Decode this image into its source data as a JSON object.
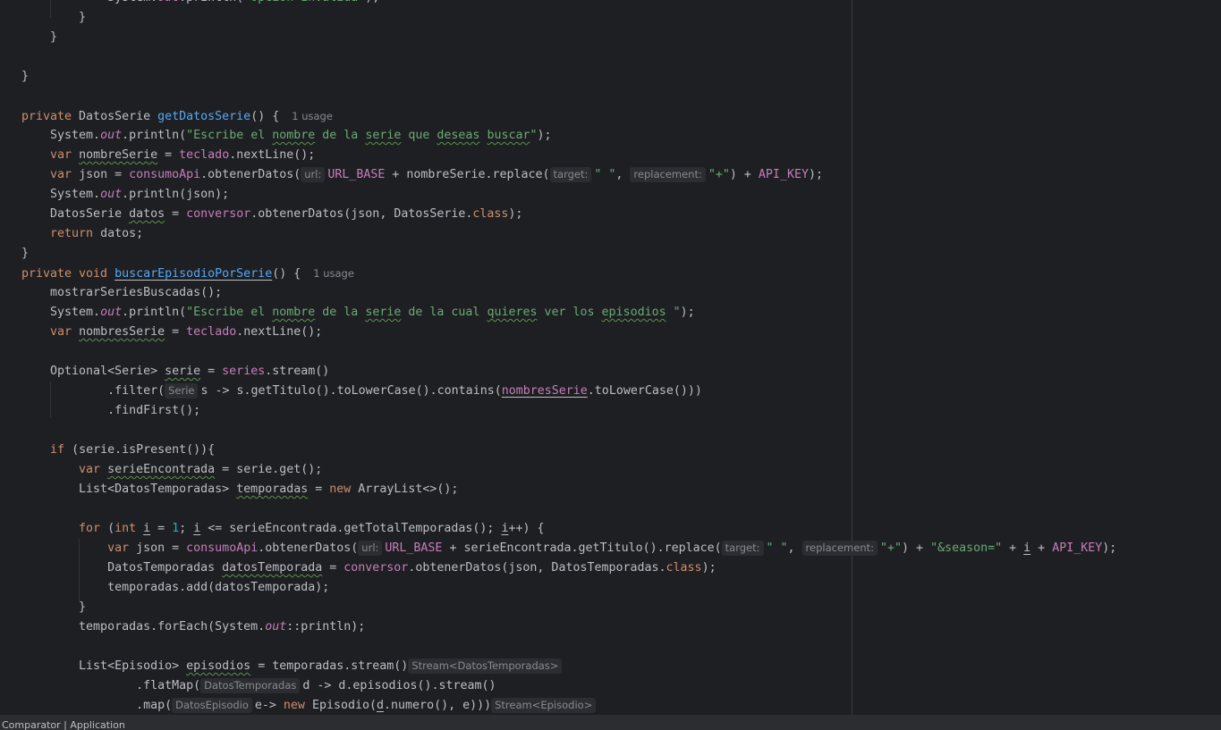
{
  "editor": {
    "lines": [
      [
        {
          "t": "            System.",
          "c": ""
        },
        {
          "t": "out",
          "c": "fld it"
        },
        {
          "t": ".println(",
          "c": ""
        },
        {
          "t": "\"Opcion invalida\"",
          "c": "st"
        },
        {
          "t": ");",
          "c": ""
        }
      ],
      [
        {
          "t": "        }",
          "c": ""
        }
      ],
      [
        {
          "t": "    }",
          "c": ""
        }
      ],
      [],
      [
        {
          "t": "}",
          "c": ""
        }
      ],
      [],
      [
        {
          "t": "private ",
          "c": "kw"
        },
        {
          "t": "DatosSerie ",
          "c": ""
        },
        {
          "t": "getDatosSerie",
          "c": "fn"
        },
        {
          "t": "() {",
          "c": ""
        },
        {
          "t": "1 usage",
          "k": "hint"
        }
      ],
      [
        {
          "t": "    System.",
          "c": ""
        },
        {
          "t": "out",
          "c": "fld it"
        },
        {
          "t": ".println(",
          "c": ""
        },
        {
          "t": "\"Escribe el ",
          "c": "st"
        },
        {
          "t": "nombre",
          "c": "st wv"
        },
        {
          "t": " de la ",
          "c": "st"
        },
        {
          "t": "serie",
          "c": "st wv"
        },
        {
          "t": " que ",
          "c": "st"
        },
        {
          "t": "deseas",
          "c": "st wv"
        },
        {
          "t": " ",
          "c": "st"
        },
        {
          "t": "buscar",
          "c": "st wv"
        },
        {
          "t": "\"",
          "c": "st"
        },
        {
          "t": ");",
          "c": ""
        }
      ],
      [
        {
          "t": "    ",
          "c": ""
        },
        {
          "t": "var ",
          "c": "kw"
        },
        {
          "t": "nombreSerie",
          "c": "wv"
        },
        {
          "t": " = ",
          "c": ""
        },
        {
          "t": "teclado",
          "c": "fld"
        },
        {
          "t": ".nextLine();",
          "c": ""
        }
      ],
      [
        {
          "t": "    ",
          "c": ""
        },
        {
          "t": "var ",
          "c": "kw"
        },
        {
          "t": "json = ",
          "c": ""
        },
        {
          "t": "consumoApi",
          "c": "fld"
        },
        {
          "t": ".obtenerDatos(",
          "c": ""
        },
        {
          "t": "url:",
          "k": "ph"
        },
        {
          "t": "URL_BASE",
          "c": "fld"
        },
        {
          "t": " + nombreSerie.replace(",
          "c": ""
        },
        {
          "t": "target:",
          "k": "ph"
        },
        {
          "t": "\" \"",
          "c": "st"
        },
        {
          "t": ", ",
          "c": ""
        },
        {
          "t": "replacement:",
          "k": "ph"
        },
        {
          "t": "\"+\"",
          "c": "st"
        },
        {
          "t": ") + ",
          "c": ""
        },
        {
          "t": "API_KEY",
          "c": "fld"
        },
        {
          "t": ");",
          "c": ""
        }
      ],
      [
        {
          "t": "    System.",
          "c": ""
        },
        {
          "t": "out",
          "c": "fld it"
        },
        {
          "t": ".println(json);",
          "c": ""
        }
      ],
      [
        {
          "t": "    DatosSerie ",
          "c": ""
        },
        {
          "t": "datos",
          "c": "wv"
        },
        {
          "t": " = ",
          "c": ""
        },
        {
          "t": "conversor",
          "c": "fld"
        },
        {
          "t": ".obtenerDatos(json, DatosSerie.",
          "c": ""
        },
        {
          "t": "class",
          "c": "kw"
        },
        {
          "t": ");",
          "c": ""
        }
      ],
      [
        {
          "t": "    ",
          "c": ""
        },
        {
          "t": "return ",
          "c": "kw"
        },
        {
          "t": "datos;",
          "c": ""
        }
      ],
      [
        {
          "t": "}",
          "c": ""
        }
      ],
      [
        {
          "t": "private void ",
          "c": "kw"
        },
        {
          "t": "buscarEpisodioPorSerie",
          "c": "fn u"
        },
        {
          "t": "() {",
          "c": ""
        },
        {
          "t": "1 usage",
          "k": "hint"
        }
      ],
      [
        {
          "t": "    mostrarSeriesBuscadas();",
          "c": ""
        }
      ],
      [
        {
          "t": "    System.",
          "c": ""
        },
        {
          "t": "out",
          "c": "fld it"
        },
        {
          "t": ".println(",
          "c": ""
        },
        {
          "t": "\"Escribe el ",
          "c": "st"
        },
        {
          "t": "nombre",
          "c": "st wv"
        },
        {
          "t": " de la ",
          "c": "st"
        },
        {
          "t": "serie",
          "c": "st wv"
        },
        {
          "t": " de la cual ",
          "c": "st"
        },
        {
          "t": "quieres",
          "c": "st wv"
        },
        {
          "t": " ver los ",
          "c": "st"
        },
        {
          "t": "episodios",
          "c": "st wv"
        },
        {
          "t": " \"",
          "c": "st"
        },
        {
          "t": ");",
          "c": ""
        }
      ],
      [
        {
          "t": "    ",
          "c": ""
        },
        {
          "t": "var ",
          "c": "kw"
        },
        {
          "t": "nombresSerie",
          "c": "wv"
        },
        {
          "t": " = ",
          "c": ""
        },
        {
          "t": "teclado",
          "c": "fld"
        },
        {
          "t": ".nextLine();",
          "c": ""
        }
      ],
      [],
      [
        {
          "t": "    Optional<Serie> ",
          "c": ""
        },
        {
          "t": "serie",
          "c": "wv"
        },
        {
          "t": " = ",
          "c": ""
        },
        {
          "t": "series",
          "c": "fld"
        },
        {
          "t": ".stream()",
          "c": ""
        }
      ],
      [
        {
          "t": "            .filter(",
          "c": ""
        },
        {
          "t": "Serie",
          "k": "ph"
        },
        {
          "t": "s -> s.getTitulo().toLowerCase().contains(",
          "c": ""
        },
        {
          "t": "nombresSerie",
          "c": "fld u"
        },
        {
          "t": ".toLowerCase()))",
          "c": ""
        }
      ],
      [
        {
          "t": "            .findFirst();",
          "c": ""
        }
      ],
      [],
      [
        {
          "t": "    ",
          "c": ""
        },
        {
          "t": "if ",
          "c": "kw"
        },
        {
          "t": "(serie.isPresent()){",
          "c": ""
        }
      ],
      [
        {
          "t": "        ",
          "c": ""
        },
        {
          "t": "var ",
          "c": "kw"
        },
        {
          "t": "serieEncontrada",
          "c": "wv"
        },
        {
          "t": " = serie.get();",
          "c": ""
        }
      ],
      [
        {
          "t": "        List<DatosTemporadas> ",
          "c": ""
        },
        {
          "t": "temporadas",
          "c": "wv"
        },
        {
          "t": " = ",
          "c": ""
        },
        {
          "t": "new ",
          "c": "kw"
        },
        {
          "t": "ArrayList<>();",
          "c": ""
        }
      ],
      [],
      [
        {
          "t": "        ",
          "c": ""
        },
        {
          "t": "for ",
          "c": "kw"
        },
        {
          "t": "(",
          "c": ""
        },
        {
          "t": "int ",
          "c": "kw"
        },
        {
          "t": "i",
          "c": "u"
        },
        {
          "t": " = ",
          "c": ""
        },
        {
          "t": "1",
          "c": "num"
        },
        {
          "t": "; ",
          "c": ""
        },
        {
          "t": "i",
          "c": "u"
        },
        {
          "t": " <= serieEncontrada.getTotalTemporadas(); ",
          "c": ""
        },
        {
          "t": "i",
          "c": "u"
        },
        {
          "t": "++) {",
          "c": ""
        }
      ],
      [
        {
          "t": "            ",
          "c": ""
        },
        {
          "t": "var ",
          "c": "kw"
        },
        {
          "t": "json = ",
          "c": ""
        },
        {
          "t": "consumoApi",
          "c": "fld"
        },
        {
          "t": ".obtenerDatos(",
          "c": ""
        },
        {
          "t": "url:",
          "k": "ph"
        },
        {
          "t": "URL_BASE",
          "c": "fld"
        },
        {
          "t": " + serieEncontrada.getTitulo().replace(",
          "c": ""
        },
        {
          "t": "target:",
          "k": "ph"
        },
        {
          "t": "\" \"",
          "c": "st"
        },
        {
          "t": ", ",
          "c": ""
        },
        {
          "t": "replacement:",
          "k": "ph"
        },
        {
          "t": "\"+\"",
          "c": "st"
        },
        {
          "t": ") + ",
          "c": ""
        },
        {
          "t": "\"&season=\"",
          "c": "st"
        },
        {
          "t": " + ",
          "c": ""
        },
        {
          "t": "i",
          "c": "u"
        },
        {
          "t": " + ",
          "c": ""
        },
        {
          "t": "API_KEY",
          "c": "fld"
        },
        {
          "t": ");",
          "c": ""
        }
      ],
      [
        {
          "t": "            DatosTemporadas ",
          "c": ""
        },
        {
          "t": "datosTemporada",
          "c": "wv"
        },
        {
          "t": " = ",
          "c": ""
        },
        {
          "t": "conversor",
          "c": "fld"
        },
        {
          "t": ".obtenerDatos(json, DatosTemporadas.",
          "c": ""
        },
        {
          "t": "class",
          "c": "kw"
        },
        {
          "t": ");",
          "c": ""
        }
      ],
      [
        {
          "t": "            temporadas.add(datosTemporada);",
          "c": ""
        }
      ],
      [
        {
          "t": "        }",
          "c": ""
        }
      ],
      [
        {
          "t": "        temporadas.forEach(System.",
          "c": ""
        },
        {
          "t": "out",
          "c": "fld it"
        },
        {
          "t": "::println);",
          "c": ""
        }
      ],
      [],
      [
        {
          "t": "        List<Episodio> ",
          "c": ""
        },
        {
          "t": "episodios",
          "c": "wv"
        },
        {
          "t": " = temporadas.stream()",
          "c": ""
        },
        {
          "t": "Stream<DatosTemporadas>",
          "k": "ph"
        }
      ],
      [
        {
          "t": "                .flatMap(",
          "c": ""
        },
        {
          "t": "DatosTemporadas",
          "k": "ph"
        },
        {
          "t": "d -> d.episodios().stream()",
          "c": ""
        }
      ],
      [
        {
          "t": "                .map(",
          "c": ""
        },
        {
          "t": "DatosEpisodio",
          "k": "ph"
        },
        {
          "t": "e-> ",
          "c": ""
        },
        {
          "t": "new ",
          "c": "kw"
        },
        {
          "t": "Episodio(",
          "c": ""
        },
        {
          "t": "d",
          "c": "u"
        },
        {
          "t": ".numero(), e)))",
          "c": ""
        },
        {
          "t": "Stream<Episodio>",
          "k": "ph"
        }
      ]
    ]
  },
  "statusbar": {
    "text": "Comparator | Application"
  }
}
